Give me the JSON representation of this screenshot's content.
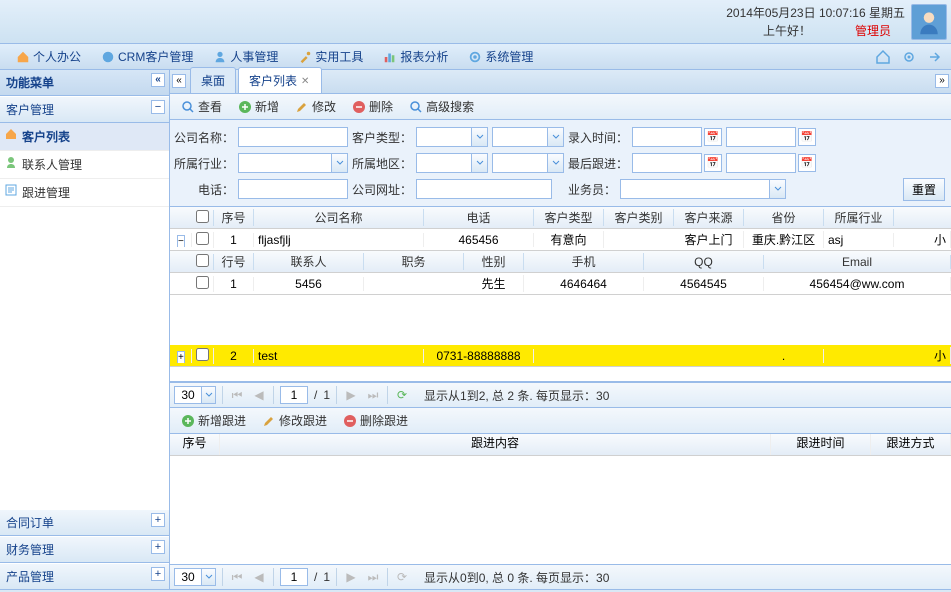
{
  "header": {
    "datetime": "2014年05月23日 10:07:16 星期五",
    "greeting": "上午好！",
    "admin": "管理员"
  },
  "mainnav": {
    "items": [
      {
        "label": "个人办公",
        "icon": "home"
      },
      {
        "label": "CRM客户管理",
        "icon": "crm"
      },
      {
        "label": "人事管理",
        "icon": "user"
      },
      {
        "label": "实用工具",
        "icon": "tool"
      },
      {
        "label": "报表分析",
        "icon": "chart"
      },
      {
        "label": "系统管理",
        "icon": "gear"
      }
    ]
  },
  "sidebar": {
    "title": "功能菜单",
    "groups": {
      "customer": {
        "title": "客户管理",
        "expanded": true,
        "items": [
          {
            "label": "客户列表",
            "active": true
          },
          {
            "label": "联系人管理"
          },
          {
            "label": "跟进管理"
          }
        ]
      },
      "contract": {
        "title": "合同订单"
      },
      "finance": {
        "title": "财务管理"
      },
      "product": {
        "title": "产品管理"
      }
    }
  },
  "tabs": {
    "desktop": "桌面",
    "customers": "客户列表"
  },
  "toolbar": {
    "view": "查看",
    "add": "新增",
    "edit": "修改",
    "del": "删除",
    "adv": "高级搜索"
  },
  "search": {
    "company_label": "公司名称：",
    "type_label": "客户类型：",
    "time_label": "录入时间：",
    "industry_label": "所属行业：",
    "region_label": "所属地区：",
    "last_label": "最后跟进：",
    "phone_label": "电话：",
    "website_label": "公司网址：",
    "salesman_label": "业务员：",
    "reset": "重置"
  },
  "grid": {
    "columns": {
      "seq": "序号",
      "company": "公司名称",
      "phone": "电话",
      "type": "客户类型",
      "cat": "客户类别",
      "source": "客户来源",
      "province": "省份",
      "industry": "所属行业"
    },
    "rows": [
      {
        "seq": "1",
        "company": "fljasfjlj",
        "phone": "465456",
        "type": "有意向",
        "cat": "",
        "source": "客户上门",
        "province": "重庆.黔江区",
        "industry": "asj",
        "tail": "小"
      },
      {
        "seq": "2",
        "company": "test",
        "phone": "0731-88888888",
        "type": "",
        "cat": "",
        "source": "",
        "province": ".",
        "industry": "",
        "tail": "小"
      }
    ],
    "sub": {
      "columns": {
        "seq": "行号",
        "contact": "联系人",
        "title": "职务",
        "gender": "性别",
        "mobile": "手机",
        "qq": "QQ",
        "email": "Email"
      },
      "rows": [
        {
          "seq": "1",
          "contact": "5456",
          "title": "",
          "gender": "先生",
          "mobile": "4646464",
          "qq": "4564545",
          "email": "456454@ww.com"
        }
      ]
    }
  },
  "pager1": {
    "size": "30",
    "page": "1",
    "total_pages": "1",
    "summary": "显示从1到2, 总 2 条. 每页显示：30"
  },
  "follow": {
    "toolbar": {
      "add": "新增跟进",
      "edit": "修改跟进",
      "del": "删除跟进"
    },
    "columns": {
      "seq": "序号",
      "content": "跟进内容",
      "time": "跟进时间",
      "method": "跟进方式"
    }
  },
  "pager2": {
    "size": "30",
    "page": "1",
    "total_pages": "1",
    "summary": "显示从0到0, 总 0 条. 每页显示：30"
  }
}
